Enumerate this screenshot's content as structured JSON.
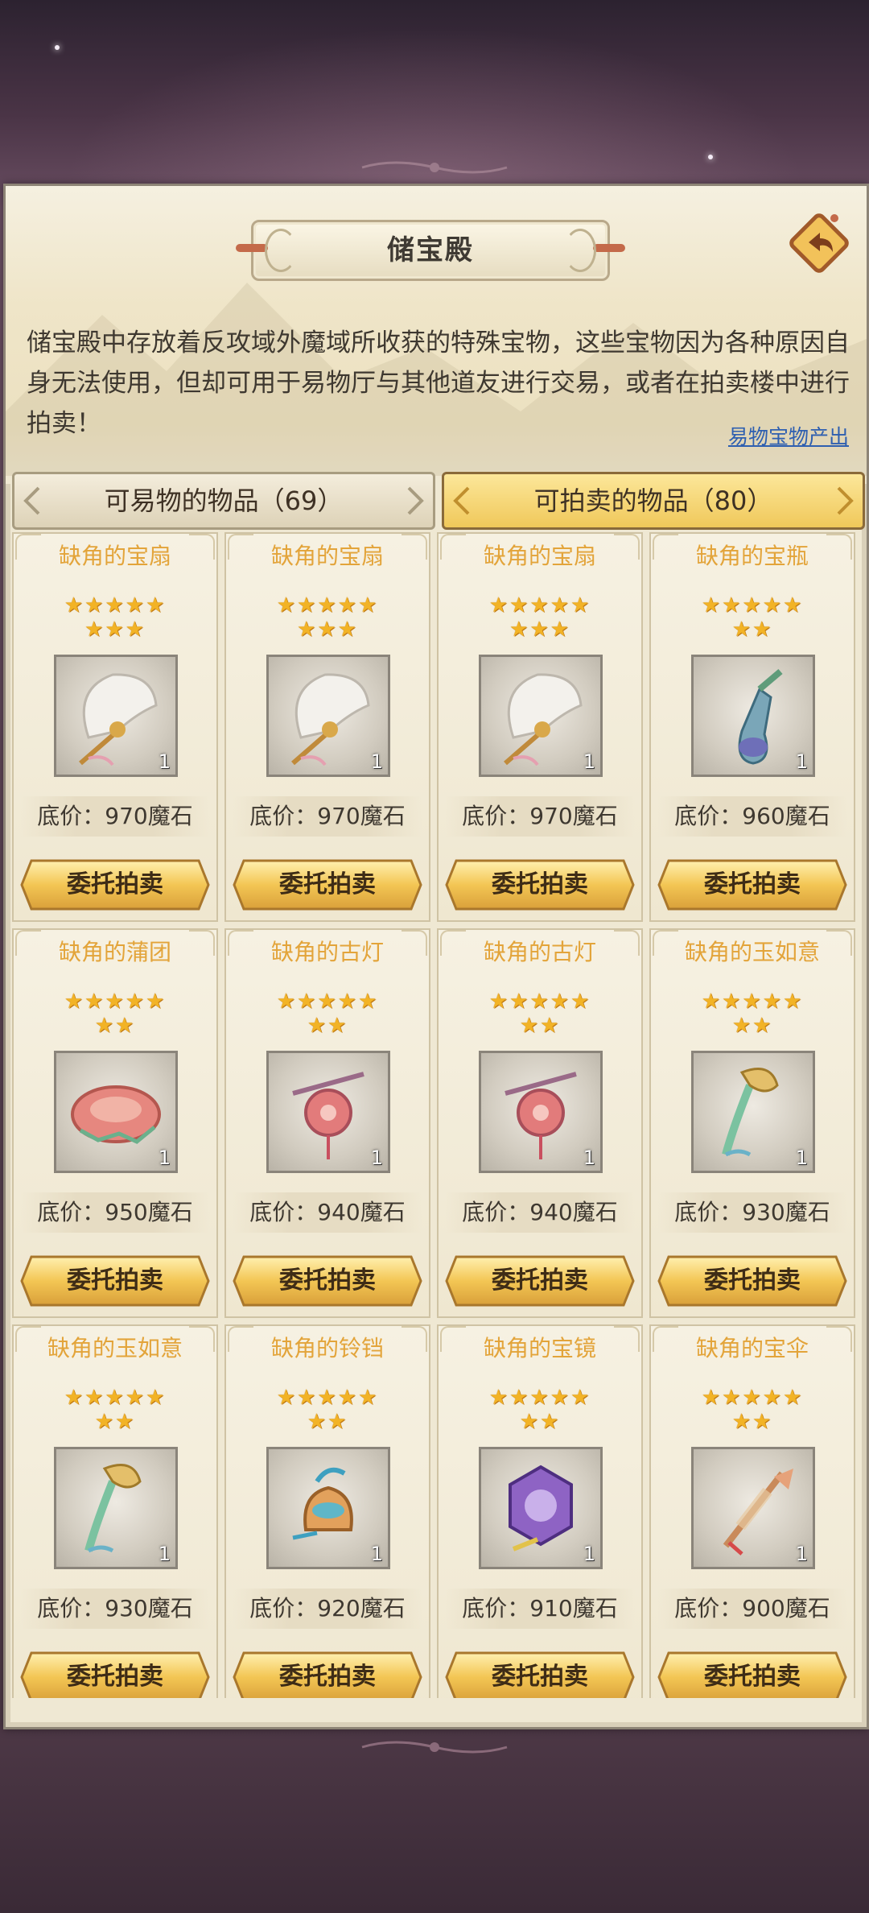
{
  "window": {
    "title": "储宝殿"
  },
  "description": "储宝殿中存放着反攻域外魔域所收获的特殊宝物，这些宝物因为各种原因自身无法使用，但却可用于易物厅与其他道友进行交易，或者在拍卖楼中进行拍卖！",
  "source_link": "易物宝物产出",
  "tabs": [
    {
      "label": "可易物的物品（69）",
      "active": false
    },
    {
      "label": "可拍卖的物品（80）",
      "active": true
    }
  ],
  "items": [
    {
      "name": "缺角的宝扇",
      "stars_row1": "★★★★★",
      "stars_row2": "★★★",
      "icon": "fan-icon",
      "qty": "1",
      "price": "底价：970魔石",
      "button": "委托拍卖"
    },
    {
      "name": "缺角的宝扇",
      "stars_row1": "★★★★★",
      "stars_row2": "★★★",
      "icon": "fan-icon",
      "qty": "1",
      "price": "底价：970魔石",
      "button": "委托拍卖"
    },
    {
      "name": "缺角的宝扇",
      "stars_row1": "★★★★★",
      "stars_row2": "★★★",
      "icon": "fan-icon",
      "qty": "1",
      "price": "底价：970魔石",
      "button": "委托拍卖"
    },
    {
      "name": "缺角的宝瓶",
      "stars_row1": "★★★★★",
      "stars_row2": "★★",
      "icon": "vase-icon",
      "qty": "1",
      "price": "底价：960魔石",
      "button": "委托拍卖"
    },
    {
      "name": "缺角的蒲团",
      "stars_row1": "★★★★★",
      "stars_row2": "★★",
      "icon": "cushion-icon",
      "qty": "1",
      "price": "底价：950魔石",
      "button": "委托拍卖"
    },
    {
      "name": "缺角的古灯",
      "stars_row1": "★★★★★",
      "stars_row2": "★★",
      "icon": "lamp-icon",
      "qty": "1",
      "price": "底价：940魔石",
      "button": "委托拍卖"
    },
    {
      "name": "缺角的古灯",
      "stars_row1": "★★★★★",
      "stars_row2": "★★",
      "icon": "lamp-icon",
      "qty": "1",
      "price": "底价：940魔石",
      "button": "委托拍卖"
    },
    {
      "name": "缺角的玉如意",
      "stars_row1": "★★★★★",
      "stars_row2": "★★",
      "icon": "ruyi-icon",
      "qty": "1",
      "price": "底价：930魔石",
      "button": "委托拍卖"
    },
    {
      "name": "缺角的玉如意",
      "stars_row1": "★★★★★",
      "stars_row2": "★★",
      "icon": "ruyi-icon",
      "qty": "1",
      "price": "底价：930魔石",
      "button": "委托拍卖"
    },
    {
      "name": "缺角的铃铛",
      "stars_row1": "★★★★★",
      "stars_row2": "★★",
      "icon": "bell-icon",
      "qty": "1",
      "price": "底价：920魔石",
      "button": "委托拍卖"
    },
    {
      "name": "缺角的宝镜",
      "stars_row1": "★★★★★",
      "stars_row2": "★★",
      "icon": "mirror-icon",
      "qty": "1",
      "price": "底价：910魔石",
      "button": "委托拍卖"
    },
    {
      "name": "缺角的宝伞",
      "stars_row1": "★★★★★",
      "stars_row2": "★★",
      "icon": "umbrella-icon",
      "qty": "1",
      "price": "底价：900魔石",
      "button": "委托拍卖"
    }
  ],
  "colors": {
    "accent_gold": "#f0c85a",
    "item_name": "#e3a43a",
    "panel_bg": "#efe8d3"
  }
}
